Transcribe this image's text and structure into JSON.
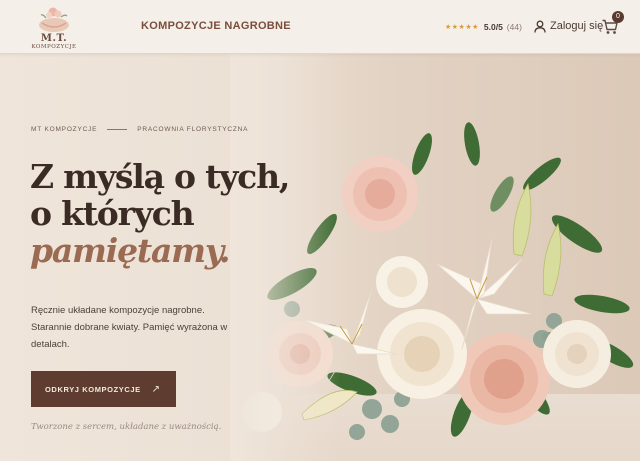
{
  "header": {
    "logo": {
      "main": "M.T.",
      "sub": "KOMPOZYCJE"
    },
    "nav": {
      "kompozycje": "KOMPOZYCJE NAGROBNE"
    },
    "rating": {
      "stars": "★★★★★",
      "score": "5.0/5",
      "count": "(44)"
    },
    "login": {
      "label": "Zaloguj się"
    },
    "cart": {
      "count": "0"
    }
  },
  "hero": {
    "eyebrow": {
      "left": "MT KOMPOZYCJE",
      "right": "PRACOWNIA FLORYSTYCZNA"
    },
    "headline": {
      "line1": "Z myślą o tych,",
      "line2": "o których",
      "line3": "pamiętamy."
    },
    "description": "Ręcznie układane kompozycje nagrobne. Starannie dobrane kwiaty. Pamięć wyrażona w detalach.",
    "cta": {
      "label": "ODKRYJ KOMPOZYCJE",
      "arrow": "↗"
    },
    "tagline": "Tworzone z sercem, układane z uważnością."
  },
  "colors": {
    "accent": "#5e3d30",
    "accent_text": "#9a6a52",
    "background": "#efe6dc",
    "star": "#d89b3a"
  },
  "icons": [
    "logo-icon",
    "user-icon",
    "cart-icon",
    "arrow-up-right-icon"
  ]
}
